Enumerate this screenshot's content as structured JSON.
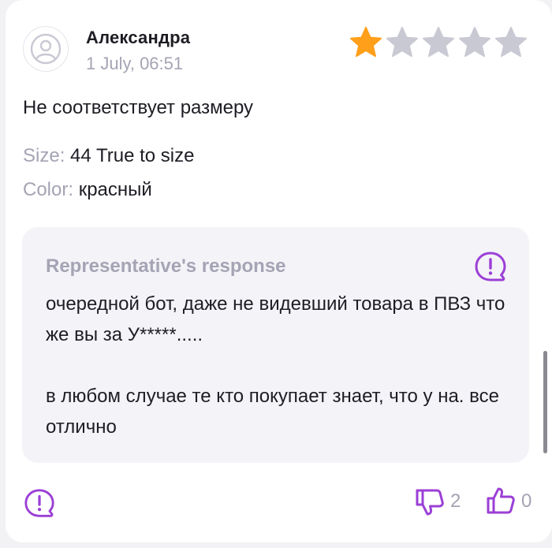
{
  "review": {
    "author": "Александра",
    "date": "1 July, 06:51",
    "rating": 1,
    "max_rating": 5,
    "text": "Не соответствует размеру",
    "size_label": "Size:",
    "size_value": "44 True to size",
    "color_label": "Color:",
    "color_value": "красный"
  },
  "response": {
    "title": "Representative's response",
    "line1": "очередной бот, даже не видевший товара в ПВЗ что же вы за У*****.....",
    "line2": "в любом случае те кто покупает знает, что у на. все отлично"
  },
  "actions": {
    "dislike_count": "2",
    "like_count": "0"
  },
  "colors": {
    "accent": "#9b3fd6",
    "star_filled": "#ff9f1a",
    "star_empty": "#c9c9d4",
    "muted_text": "#a4a4b4"
  },
  "icons": {
    "avatar": "user-avatar-icon",
    "report": "exclamation-bubble-icon",
    "dislike": "thumbs-down-icon",
    "like": "thumbs-up-icon",
    "star": "star-icon"
  }
}
